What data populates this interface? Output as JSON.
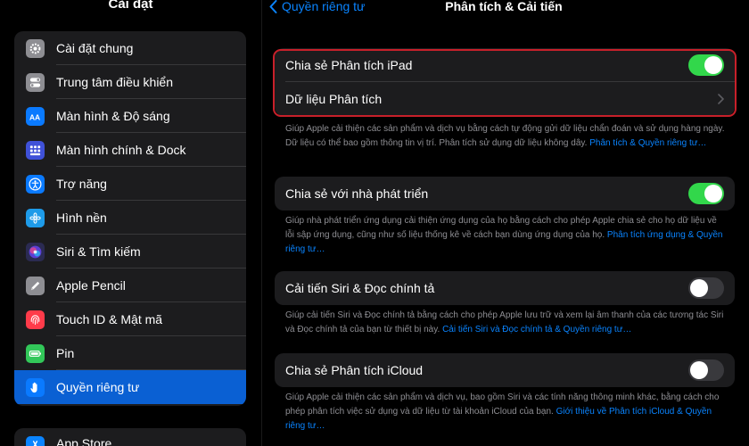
{
  "sidebar": {
    "title": "Cài đặt",
    "items": [
      {
        "label": "Cài đặt chung",
        "icon": "gear-icon",
        "color": "#8e8e93"
      },
      {
        "label": "Trung tâm điều khiển",
        "icon": "control-center-icon",
        "color": "#8e8e93"
      },
      {
        "label": "Màn hình & Độ sáng",
        "icon": "display-brightness-icon",
        "color": "#0a7aff"
      },
      {
        "label": "Màn hình chính & Dock",
        "icon": "home-screen-icon",
        "color": "#3f51d8"
      },
      {
        "label": "Trợ năng",
        "icon": "accessibility-icon",
        "color": "#0a7aff"
      },
      {
        "label": "Hình nền",
        "icon": "wallpaper-icon",
        "color": "#1e9be9"
      },
      {
        "label": "Siri & Tìm kiếm",
        "icon": "siri-icon",
        "color": "#2b2b52"
      },
      {
        "label": "Apple Pencil",
        "icon": "pencil-icon",
        "color": "#8e8e93"
      },
      {
        "label": "Touch ID & Mật mã",
        "icon": "fingerprint-icon",
        "color": "#ff3b4a"
      },
      {
        "label": "Pin",
        "icon": "battery-icon",
        "color": "#32c759"
      },
      {
        "label": "Quyền riêng tư",
        "icon": "hand-icon",
        "color": "#0a7aff",
        "selected": true
      }
    ],
    "next_item": {
      "label": "App Store",
      "icon": "app-store-icon",
      "color": "#0a84ff"
    }
  },
  "header": {
    "back_label": "Quyền riêng tư",
    "title": "Phân tích & Cải tiến"
  },
  "sections": [
    {
      "rows": [
        {
          "label": "Chia sẻ Phân tích iPad",
          "control": "toggle",
          "on": true
        },
        {
          "label": "Dữ liệu Phân tích",
          "control": "chevron"
        }
      ],
      "note": "Giúp Apple cải thiện các sản phẩm và dịch vụ bằng cách tự động gửi dữ liệu chẩn đoán và sử dụng hàng ngày. Dữ liệu có thể bao gồm thông tin vị trí. Phân tích sử dụng dữ liệu không dây.",
      "link": "Phân tích & Quyền riêng tư…"
    },
    {
      "rows": [
        {
          "label": "Chia sẻ với nhà phát triển",
          "control": "toggle",
          "on": true
        }
      ],
      "note": "Giúp nhà phát triển ứng dụng cải thiện ứng dụng của họ bằng cách cho phép Apple chia sẻ cho họ dữ liệu về lỗi sập ứng dụng, cũng như số liệu thống kê về cách bạn dùng ứng dụng của họ.",
      "link": "Phân tích ứng dụng & Quyền riêng tư…"
    },
    {
      "rows": [
        {
          "label": "Cải tiến Siri & Đọc chính tả",
          "control": "toggle",
          "on": false
        }
      ],
      "note": "Giúp cải tiến Siri và Đọc chính tả bằng cách cho phép Apple lưu trữ và xem lại âm thanh của các tương tác Siri và Đọc chính tả của bạn từ thiết bị này.",
      "link": "Cải tiến Siri và Đọc chính tả & Quyền riêng tư…"
    },
    {
      "rows": [
        {
          "label": "Chia sẻ Phân tích iCloud",
          "control": "toggle",
          "on": false
        }
      ],
      "note": "Giúp Apple cải thiện các sản phẩm và dịch vụ, bao gồm Siri và các tính năng thông minh khác, bằng cách cho phép phân tích việc sử dụng và dữ liệu từ tài khoản iCloud của bạn.",
      "link": "Giới thiệu về Phân tích iCloud & Quyền riêng tư…"
    }
  ],
  "colors": {
    "accent": "#0a84ff",
    "toggle_on": "#32d74b",
    "highlight": "#c8202a"
  }
}
